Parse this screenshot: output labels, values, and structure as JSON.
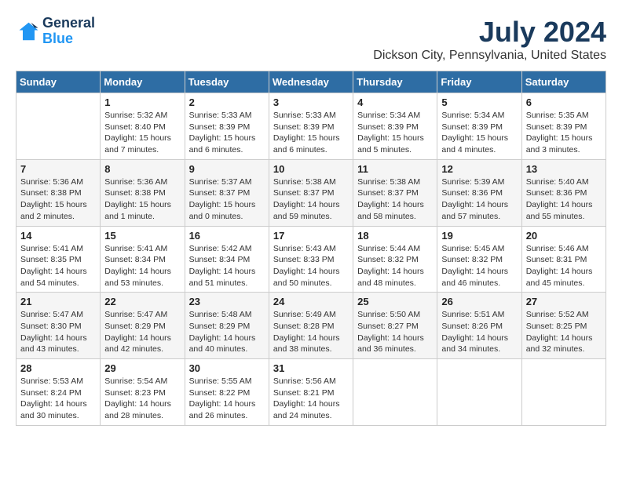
{
  "logo": {
    "line1": "General",
    "line2": "Blue"
  },
  "title": {
    "month_year": "July 2024",
    "location": "Dickson City, Pennsylvania, United States"
  },
  "header_days": [
    "Sunday",
    "Monday",
    "Tuesday",
    "Wednesday",
    "Thursday",
    "Friday",
    "Saturday"
  ],
  "weeks": [
    [
      {
        "day": "",
        "info": ""
      },
      {
        "day": "1",
        "info": "Sunrise: 5:32 AM\nSunset: 8:40 PM\nDaylight: 15 hours\nand 7 minutes."
      },
      {
        "day": "2",
        "info": "Sunrise: 5:33 AM\nSunset: 8:39 PM\nDaylight: 15 hours\nand 6 minutes."
      },
      {
        "day": "3",
        "info": "Sunrise: 5:33 AM\nSunset: 8:39 PM\nDaylight: 15 hours\nand 6 minutes."
      },
      {
        "day": "4",
        "info": "Sunrise: 5:34 AM\nSunset: 8:39 PM\nDaylight: 15 hours\nand 5 minutes."
      },
      {
        "day": "5",
        "info": "Sunrise: 5:34 AM\nSunset: 8:39 PM\nDaylight: 15 hours\nand 4 minutes."
      },
      {
        "day": "6",
        "info": "Sunrise: 5:35 AM\nSunset: 8:39 PM\nDaylight: 15 hours\nand 3 minutes."
      }
    ],
    [
      {
        "day": "7",
        "info": "Sunrise: 5:36 AM\nSunset: 8:38 PM\nDaylight: 15 hours\nand 2 minutes."
      },
      {
        "day": "8",
        "info": "Sunrise: 5:36 AM\nSunset: 8:38 PM\nDaylight: 15 hours\nand 1 minute."
      },
      {
        "day": "9",
        "info": "Sunrise: 5:37 AM\nSunset: 8:37 PM\nDaylight: 15 hours\nand 0 minutes."
      },
      {
        "day": "10",
        "info": "Sunrise: 5:38 AM\nSunset: 8:37 PM\nDaylight: 14 hours\nand 59 minutes."
      },
      {
        "day": "11",
        "info": "Sunrise: 5:38 AM\nSunset: 8:37 PM\nDaylight: 14 hours\nand 58 minutes."
      },
      {
        "day": "12",
        "info": "Sunrise: 5:39 AM\nSunset: 8:36 PM\nDaylight: 14 hours\nand 57 minutes."
      },
      {
        "day": "13",
        "info": "Sunrise: 5:40 AM\nSunset: 8:36 PM\nDaylight: 14 hours\nand 55 minutes."
      }
    ],
    [
      {
        "day": "14",
        "info": "Sunrise: 5:41 AM\nSunset: 8:35 PM\nDaylight: 14 hours\nand 54 minutes."
      },
      {
        "day": "15",
        "info": "Sunrise: 5:41 AM\nSunset: 8:34 PM\nDaylight: 14 hours\nand 53 minutes."
      },
      {
        "day": "16",
        "info": "Sunrise: 5:42 AM\nSunset: 8:34 PM\nDaylight: 14 hours\nand 51 minutes."
      },
      {
        "day": "17",
        "info": "Sunrise: 5:43 AM\nSunset: 8:33 PM\nDaylight: 14 hours\nand 50 minutes."
      },
      {
        "day": "18",
        "info": "Sunrise: 5:44 AM\nSunset: 8:32 PM\nDaylight: 14 hours\nand 48 minutes."
      },
      {
        "day": "19",
        "info": "Sunrise: 5:45 AM\nSunset: 8:32 PM\nDaylight: 14 hours\nand 46 minutes."
      },
      {
        "day": "20",
        "info": "Sunrise: 5:46 AM\nSunset: 8:31 PM\nDaylight: 14 hours\nand 45 minutes."
      }
    ],
    [
      {
        "day": "21",
        "info": "Sunrise: 5:47 AM\nSunset: 8:30 PM\nDaylight: 14 hours\nand 43 minutes."
      },
      {
        "day": "22",
        "info": "Sunrise: 5:47 AM\nSunset: 8:29 PM\nDaylight: 14 hours\nand 42 minutes."
      },
      {
        "day": "23",
        "info": "Sunrise: 5:48 AM\nSunset: 8:29 PM\nDaylight: 14 hours\nand 40 minutes."
      },
      {
        "day": "24",
        "info": "Sunrise: 5:49 AM\nSunset: 8:28 PM\nDaylight: 14 hours\nand 38 minutes."
      },
      {
        "day": "25",
        "info": "Sunrise: 5:50 AM\nSunset: 8:27 PM\nDaylight: 14 hours\nand 36 minutes."
      },
      {
        "day": "26",
        "info": "Sunrise: 5:51 AM\nSunset: 8:26 PM\nDaylight: 14 hours\nand 34 minutes."
      },
      {
        "day": "27",
        "info": "Sunrise: 5:52 AM\nSunset: 8:25 PM\nDaylight: 14 hours\nand 32 minutes."
      }
    ],
    [
      {
        "day": "28",
        "info": "Sunrise: 5:53 AM\nSunset: 8:24 PM\nDaylight: 14 hours\nand 30 minutes."
      },
      {
        "day": "29",
        "info": "Sunrise: 5:54 AM\nSunset: 8:23 PM\nDaylight: 14 hours\nand 28 minutes."
      },
      {
        "day": "30",
        "info": "Sunrise: 5:55 AM\nSunset: 8:22 PM\nDaylight: 14 hours\nand 26 minutes."
      },
      {
        "day": "31",
        "info": "Sunrise: 5:56 AM\nSunset: 8:21 PM\nDaylight: 14 hours\nand 24 minutes."
      },
      {
        "day": "",
        "info": ""
      },
      {
        "day": "",
        "info": ""
      },
      {
        "day": "",
        "info": ""
      }
    ]
  ]
}
